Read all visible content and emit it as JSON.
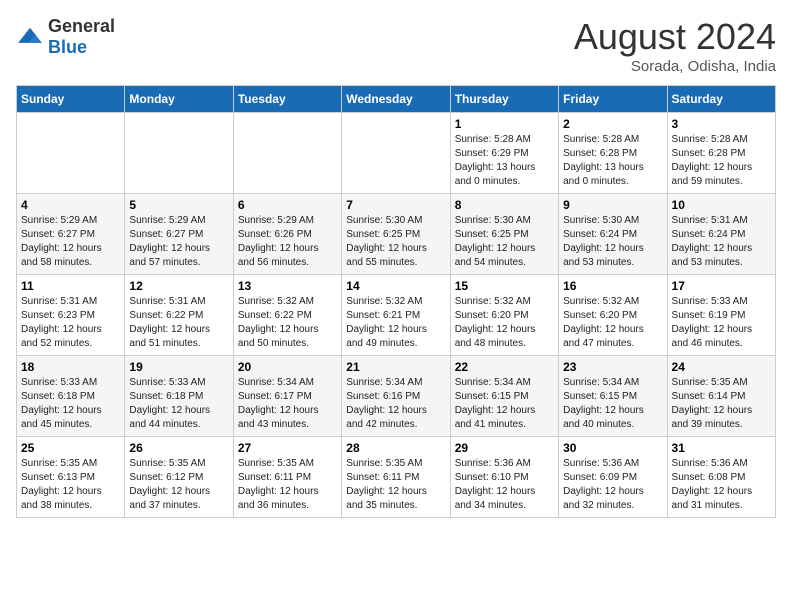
{
  "logo": {
    "general": "General",
    "blue": "Blue"
  },
  "title": "August 2024",
  "location": "Sorada, Odisha, India",
  "days_of_week": [
    "Sunday",
    "Monday",
    "Tuesday",
    "Wednesday",
    "Thursday",
    "Friday",
    "Saturday"
  ],
  "weeks": [
    [
      {
        "day": "",
        "info": ""
      },
      {
        "day": "",
        "info": ""
      },
      {
        "day": "",
        "info": ""
      },
      {
        "day": "",
        "info": ""
      },
      {
        "day": "1",
        "info": "Sunrise: 5:28 AM\nSunset: 6:29 PM\nDaylight: 13 hours\nand 0 minutes."
      },
      {
        "day": "2",
        "info": "Sunrise: 5:28 AM\nSunset: 6:28 PM\nDaylight: 13 hours\nand 0 minutes."
      },
      {
        "day": "3",
        "info": "Sunrise: 5:28 AM\nSunset: 6:28 PM\nDaylight: 12 hours\nand 59 minutes."
      }
    ],
    [
      {
        "day": "4",
        "info": "Sunrise: 5:29 AM\nSunset: 6:27 PM\nDaylight: 12 hours\nand 58 minutes."
      },
      {
        "day": "5",
        "info": "Sunrise: 5:29 AM\nSunset: 6:27 PM\nDaylight: 12 hours\nand 57 minutes."
      },
      {
        "day": "6",
        "info": "Sunrise: 5:29 AM\nSunset: 6:26 PM\nDaylight: 12 hours\nand 56 minutes."
      },
      {
        "day": "7",
        "info": "Sunrise: 5:30 AM\nSunset: 6:25 PM\nDaylight: 12 hours\nand 55 minutes."
      },
      {
        "day": "8",
        "info": "Sunrise: 5:30 AM\nSunset: 6:25 PM\nDaylight: 12 hours\nand 54 minutes."
      },
      {
        "day": "9",
        "info": "Sunrise: 5:30 AM\nSunset: 6:24 PM\nDaylight: 12 hours\nand 53 minutes."
      },
      {
        "day": "10",
        "info": "Sunrise: 5:31 AM\nSunset: 6:24 PM\nDaylight: 12 hours\nand 53 minutes."
      }
    ],
    [
      {
        "day": "11",
        "info": "Sunrise: 5:31 AM\nSunset: 6:23 PM\nDaylight: 12 hours\nand 52 minutes."
      },
      {
        "day": "12",
        "info": "Sunrise: 5:31 AM\nSunset: 6:22 PM\nDaylight: 12 hours\nand 51 minutes."
      },
      {
        "day": "13",
        "info": "Sunrise: 5:32 AM\nSunset: 6:22 PM\nDaylight: 12 hours\nand 50 minutes."
      },
      {
        "day": "14",
        "info": "Sunrise: 5:32 AM\nSunset: 6:21 PM\nDaylight: 12 hours\nand 49 minutes."
      },
      {
        "day": "15",
        "info": "Sunrise: 5:32 AM\nSunset: 6:20 PM\nDaylight: 12 hours\nand 48 minutes."
      },
      {
        "day": "16",
        "info": "Sunrise: 5:32 AM\nSunset: 6:20 PM\nDaylight: 12 hours\nand 47 minutes."
      },
      {
        "day": "17",
        "info": "Sunrise: 5:33 AM\nSunset: 6:19 PM\nDaylight: 12 hours\nand 46 minutes."
      }
    ],
    [
      {
        "day": "18",
        "info": "Sunrise: 5:33 AM\nSunset: 6:18 PM\nDaylight: 12 hours\nand 45 minutes."
      },
      {
        "day": "19",
        "info": "Sunrise: 5:33 AM\nSunset: 6:18 PM\nDaylight: 12 hours\nand 44 minutes."
      },
      {
        "day": "20",
        "info": "Sunrise: 5:34 AM\nSunset: 6:17 PM\nDaylight: 12 hours\nand 43 minutes."
      },
      {
        "day": "21",
        "info": "Sunrise: 5:34 AM\nSunset: 6:16 PM\nDaylight: 12 hours\nand 42 minutes."
      },
      {
        "day": "22",
        "info": "Sunrise: 5:34 AM\nSunset: 6:15 PM\nDaylight: 12 hours\nand 41 minutes."
      },
      {
        "day": "23",
        "info": "Sunrise: 5:34 AM\nSunset: 6:15 PM\nDaylight: 12 hours\nand 40 minutes."
      },
      {
        "day": "24",
        "info": "Sunrise: 5:35 AM\nSunset: 6:14 PM\nDaylight: 12 hours\nand 39 minutes."
      }
    ],
    [
      {
        "day": "25",
        "info": "Sunrise: 5:35 AM\nSunset: 6:13 PM\nDaylight: 12 hours\nand 38 minutes."
      },
      {
        "day": "26",
        "info": "Sunrise: 5:35 AM\nSunset: 6:12 PM\nDaylight: 12 hours\nand 37 minutes."
      },
      {
        "day": "27",
        "info": "Sunrise: 5:35 AM\nSunset: 6:11 PM\nDaylight: 12 hours\nand 36 minutes."
      },
      {
        "day": "28",
        "info": "Sunrise: 5:35 AM\nSunset: 6:11 PM\nDaylight: 12 hours\nand 35 minutes."
      },
      {
        "day": "29",
        "info": "Sunrise: 5:36 AM\nSunset: 6:10 PM\nDaylight: 12 hours\nand 34 minutes."
      },
      {
        "day": "30",
        "info": "Sunrise: 5:36 AM\nSunset: 6:09 PM\nDaylight: 12 hours\nand 32 minutes."
      },
      {
        "day": "31",
        "info": "Sunrise: 5:36 AM\nSunset: 6:08 PM\nDaylight: 12 hours\nand 31 minutes."
      }
    ]
  ]
}
